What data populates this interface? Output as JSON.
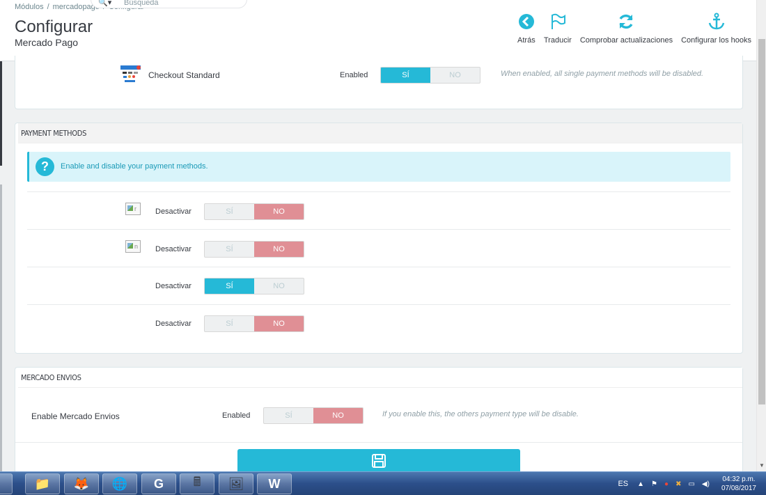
{
  "header": {
    "breadcrumb": [
      "Módulos",
      "mercadopago",
      "Configurar"
    ],
    "search_placeholder": "Búsqueda",
    "title": "Configurar",
    "subtitle": "Mercado Pago",
    "toolbar": [
      {
        "label": "Atrás",
        "icon": "arrow-left-circle-icon"
      },
      {
        "label": "Traducir",
        "icon": "flag-icon"
      },
      {
        "label": "Comprobar actualizaciones",
        "icon": "refresh-icon"
      },
      {
        "label": "Configurar los hooks",
        "icon": "anchor-icon"
      }
    ]
  },
  "checkout": {
    "label": "Checkout Standard",
    "state_label": "Enabled",
    "yes": "SÍ",
    "no": "NO",
    "help": "When enabled, all single payment methods will be disabled.",
    "value": "yes"
  },
  "payment_methods": {
    "heading": "PAYMENT METHODS",
    "alert": "Enable and disable your payment methods.",
    "rows": [
      {
        "label": "Desactivar",
        "yes": "SÍ",
        "no": "NO",
        "value": "no",
        "image_alt": "r"
      },
      {
        "label": "Desactivar",
        "yes": "SÍ",
        "no": "NO",
        "value": "no",
        "image_alt": "n"
      },
      {
        "label": "Desactivar",
        "yes": "SÍ",
        "no": "NO",
        "value": "yes"
      },
      {
        "label": "Desactivar",
        "yes": "SÍ",
        "no": "NO",
        "value": "no"
      }
    ]
  },
  "envios": {
    "heading": "MERCADO ENVIOS",
    "label": "Enable Mercado Envios",
    "state_label": "Enabled",
    "yes": "SÍ",
    "no": "NO",
    "value": "no",
    "help": "If you enable this, the others payment type will be disable."
  },
  "taskbar": {
    "language": "ES",
    "time": "04:32 p.m.",
    "date": "07/08/2017"
  },
  "colors": {
    "accent": "#25b9d7",
    "off": "#e08f95"
  }
}
